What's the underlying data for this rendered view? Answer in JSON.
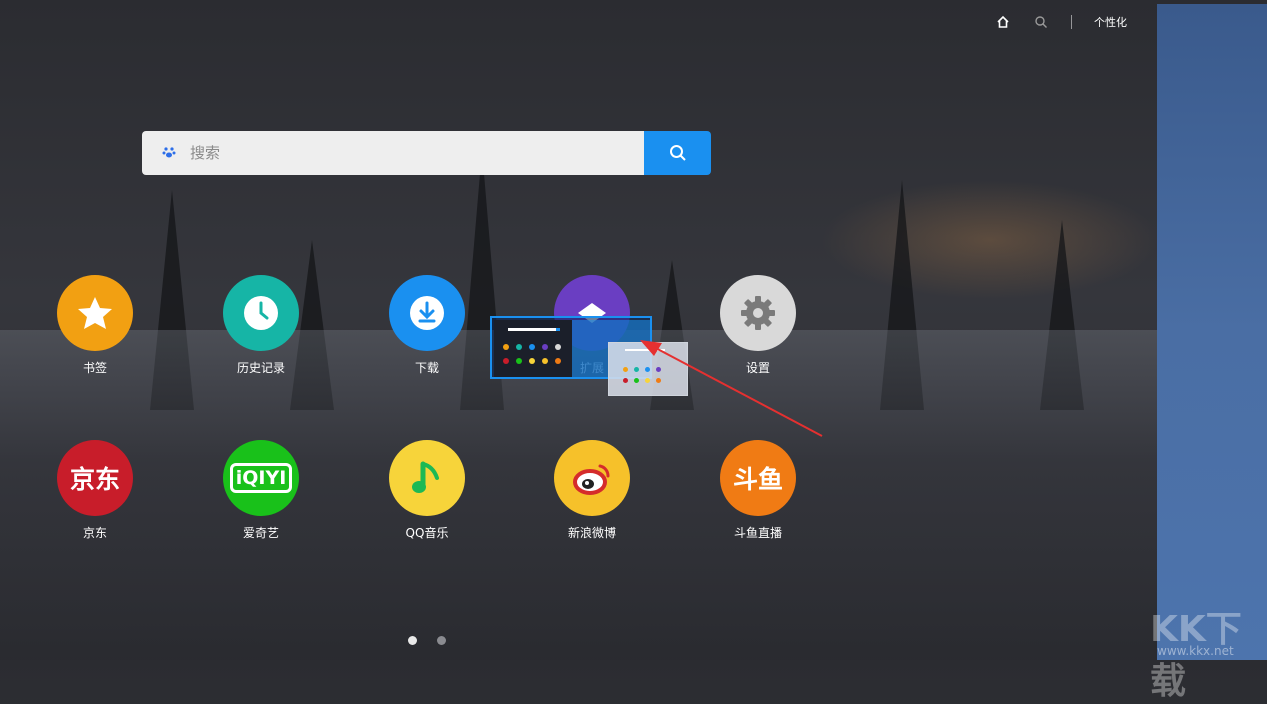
{
  "topbar": {
    "personalize_label": "个性化"
  },
  "search": {
    "placeholder": "搜索"
  },
  "tiles_row1": [
    {
      "label": "书签",
      "color": "#f2a012"
    },
    {
      "label": "历史记录",
      "color": "#16b5a6"
    },
    {
      "label": "下载",
      "color": "#1a90f0"
    },
    {
      "label": "扩展",
      "color": "#6a3ec2"
    },
    {
      "label": "设置",
      "color": "#d9d9d9"
    }
  ],
  "tiles_row2": [
    {
      "label": "京东",
      "color": "#c81d2a",
      "logo_text": "京东"
    },
    {
      "label": "爱奇艺",
      "color": "#19c11a",
      "logo_text": "iQIYI"
    },
    {
      "label": "QQ音乐",
      "color": "#f7d43a"
    },
    {
      "label": "新浪微博",
      "color": "#f6c12a"
    },
    {
      "label": "斗鱼直播",
      "color": "#f07b14",
      "logo_text": "斗鱼"
    }
  ],
  "watermark": {
    "logo": "KK下载",
    "url": "www.kkx.net"
  },
  "pagination": {
    "current": 1,
    "total": 2
  }
}
